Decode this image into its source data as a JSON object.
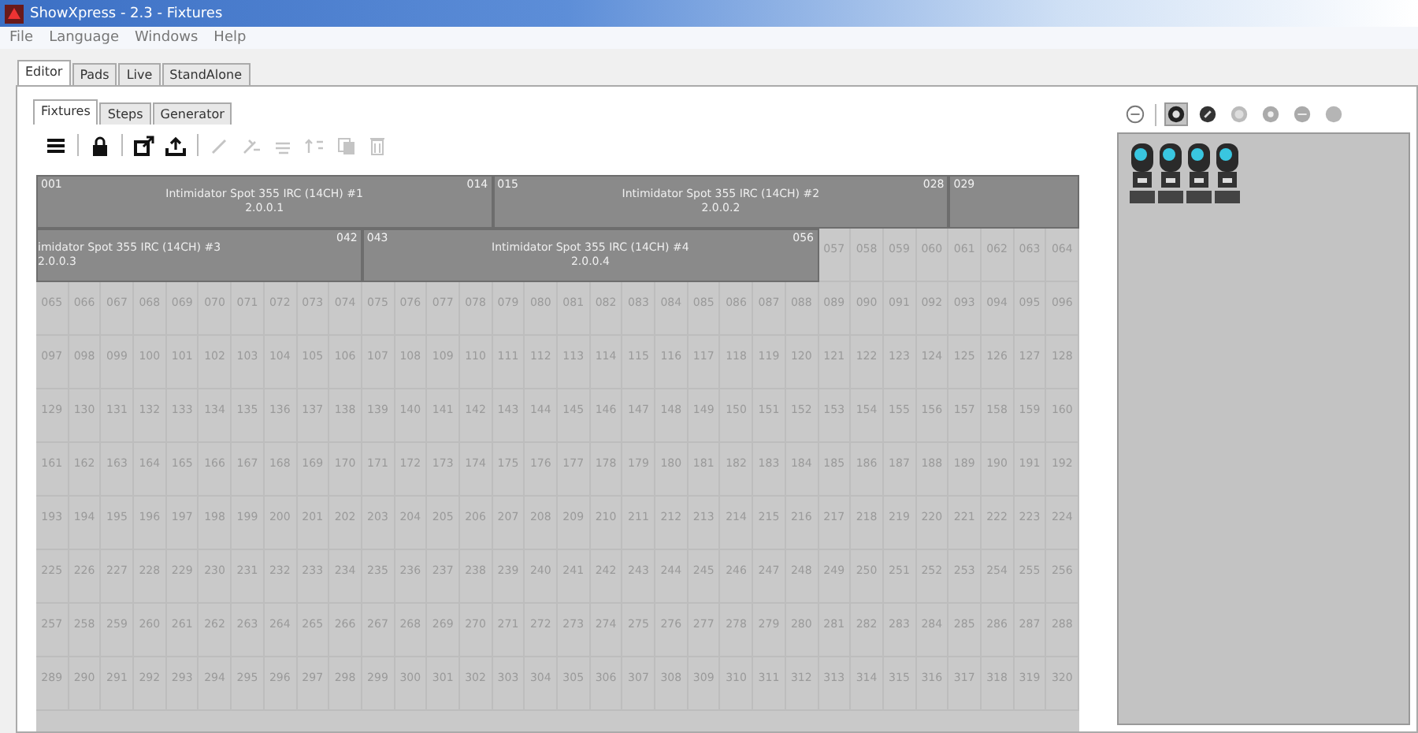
{
  "window": {
    "title": "ShowXpress - 2.3 - Fixtures"
  },
  "menu": [
    "File",
    "Language",
    "Windows",
    "Help"
  ],
  "tabs": [
    {
      "label": "Editor",
      "selected": true
    },
    {
      "label": "Pads",
      "selected": false
    },
    {
      "label": "Live",
      "selected": false
    },
    {
      "label": "StandAlone",
      "selected": false
    }
  ],
  "subtabs": [
    {
      "label": "Fixtures",
      "selected": true
    },
    {
      "label": "Steps",
      "selected": false
    },
    {
      "label": "Generator",
      "selected": false
    }
  ],
  "toolbar": [
    {
      "kind": "menu",
      "disabled": false
    },
    {
      "kind": "separator"
    },
    {
      "kind": "lock",
      "disabled": false
    },
    {
      "kind": "separator"
    },
    {
      "kind": "export",
      "disabled": false
    },
    {
      "kind": "upload",
      "disabled": false
    },
    {
      "kind": "separator"
    },
    {
      "kind": "edit",
      "disabled": true
    },
    {
      "kind": "tools",
      "disabled": true
    },
    {
      "kind": "align",
      "disabled": true
    },
    {
      "kind": "sort",
      "disabled": true
    },
    {
      "kind": "copy",
      "disabled": true
    },
    {
      "kind": "delete",
      "disabled": true
    }
  ],
  "patch_rows": [
    {
      "blocks": [
        {
          "start": "001",
          "end": "014",
          "name": "Intimidator Spot 355 IRC (14CH) #1",
          "address": "2.0.0.1"
        },
        {
          "start": "015",
          "end": "028",
          "name": "Intimidator Spot 355 IRC (14CH) #2",
          "address": "2.0.0.2"
        },
        {
          "start": "029"
        }
      ],
      "free_channels": []
    },
    {
      "blocks": [
        {
          "end": "042",
          "name": "imidator Spot 355 IRC (14CH) #3",
          "address": "2.0.0.3"
        },
        {
          "start": "043",
          "end": "056",
          "name": "Intimidator Spot 355 IRC (14CH) #4",
          "address": "2.0.0.4"
        }
      ],
      "free_channels": [
        "057",
        "058",
        "059",
        "060",
        "061",
        "062",
        "063",
        "064"
      ]
    },
    {
      "blocks": [],
      "free_channels": [
        "065",
        "066",
        "067",
        "068",
        "069",
        "070",
        "071",
        "072",
        "073",
        "074",
        "075",
        "076",
        "077",
        "078",
        "079",
        "080",
        "081",
        "082",
        "083",
        "084",
        "085",
        "086",
        "087",
        "088",
        "089",
        "090",
        "091",
        "092",
        "093",
        "094",
        "095",
        "096"
      ]
    },
    {
      "blocks": [],
      "free_channels": [
        "097",
        "098",
        "099",
        "100",
        "101",
        "102",
        "103",
        "104",
        "105",
        "106",
        "107",
        "108",
        "109",
        "110",
        "111",
        "112",
        "113",
        "114",
        "115",
        "116",
        "117",
        "118",
        "119",
        "120",
        "121",
        "122",
        "123",
        "124",
        "125",
        "126",
        "127",
        "128"
      ]
    },
    {
      "blocks": [],
      "free_channels": [
        "129",
        "130",
        "131",
        "132",
        "133",
        "134",
        "135",
        "136",
        "137",
        "138",
        "139",
        "140",
        "141",
        "142",
        "143",
        "144",
        "145",
        "146",
        "147",
        "148",
        "149",
        "150",
        "151",
        "152",
        "153",
        "154",
        "155",
        "156",
        "157",
        "158",
        "159",
        "160"
      ]
    },
    {
      "blocks": [],
      "free_channels": [
        "161",
        "162",
        "163",
        "164",
        "165",
        "166",
        "167",
        "168",
        "169",
        "170",
        "171",
        "172",
        "173",
        "174",
        "175",
        "176",
        "177",
        "178",
        "179",
        "180",
        "181",
        "182",
        "183",
        "184",
        "185",
        "186",
        "187",
        "188",
        "189",
        "190",
        "191",
        "192"
      ]
    },
    {
      "blocks": [],
      "free_channels": [
        "193",
        "194",
        "195",
        "196",
        "197",
        "198",
        "199",
        "200",
        "201",
        "202",
        "203",
        "204",
        "205",
        "206",
        "207",
        "208",
        "209",
        "210",
        "211",
        "212",
        "213",
        "214",
        "215",
        "216",
        "217",
        "218",
        "219",
        "220",
        "221",
        "222",
        "223",
        "224"
      ]
    },
    {
      "blocks": [],
      "free_channels": [
        "225",
        "226",
        "227",
        "228",
        "229",
        "230",
        "231",
        "232",
        "233",
        "234",
        "235",
        "236",
        "237",
        "238",
        "239",
        "240",
        "241",
        "242",
        "243",
        "244",
        "245",
        "246",
        "247",
        "248",
        "249",
        "250",
        "251",
        "252",
        "253",
        "254",
        "255",
        "256"
      ]
    },
    {
      "blocks": [],
      "free_channels": [
        "257",
        "258",
        "259",
        "260",
        "261",
        "262",
        "263",
        "264",
        "265",
        "266",
        "267",
        "268",
        "269",
        "270",
        "271",
        "272",
        "273",
        "274",
        "275",
        "276",
        "277",
        "278",
        "279",
        "280",
        "281",
        "282",
        "283",
        "284",
        "285",
        "286",
        "287",
        "288"
      ]
    },
    {
      "blocks": [],
      "free_channels": [
        "289",
        "290",
        "291",
        "292",
        "293",
        "294",
        "295",
        "296",
        "297",
        "298",
        "299",
        "300",
        "301",
        "302",
        "303",
        "304",
        "305",
        "306",
        "307",
        "308",
        "309",
        "310",
        "311",
        "312",
        "313",
        "314",
        "315",
        "316",
        "317",
        "318",
        "319",
        "320"
      ]
    }
  ],
  "library_filters": [
    {
      "kind": "minus",
      "selected": false
    },
    {
      "kind": "separator"
    },
    {
      "kind": "moving-head",
      "selected": true
    },
    {
      "kind": "scanner",
      "selected": false
    },
    {
      "kind": "par",
      "selected": false
    },
    {
      "kind": "effect",
      "selected": false
    },
    {
      "kind": "laser",
      "selected": false
    },
    {
      "kind": "dimmer",
      "selected": false
    }
  ],
  "library_fixtures": [
    {
      "kind": "moving-head"
    },
    {
      "kind": "moving-head"
    },
    {
      "kind": "moving-head"
    },
    {
      "kind": "moving-head"
    }
  ]
}
